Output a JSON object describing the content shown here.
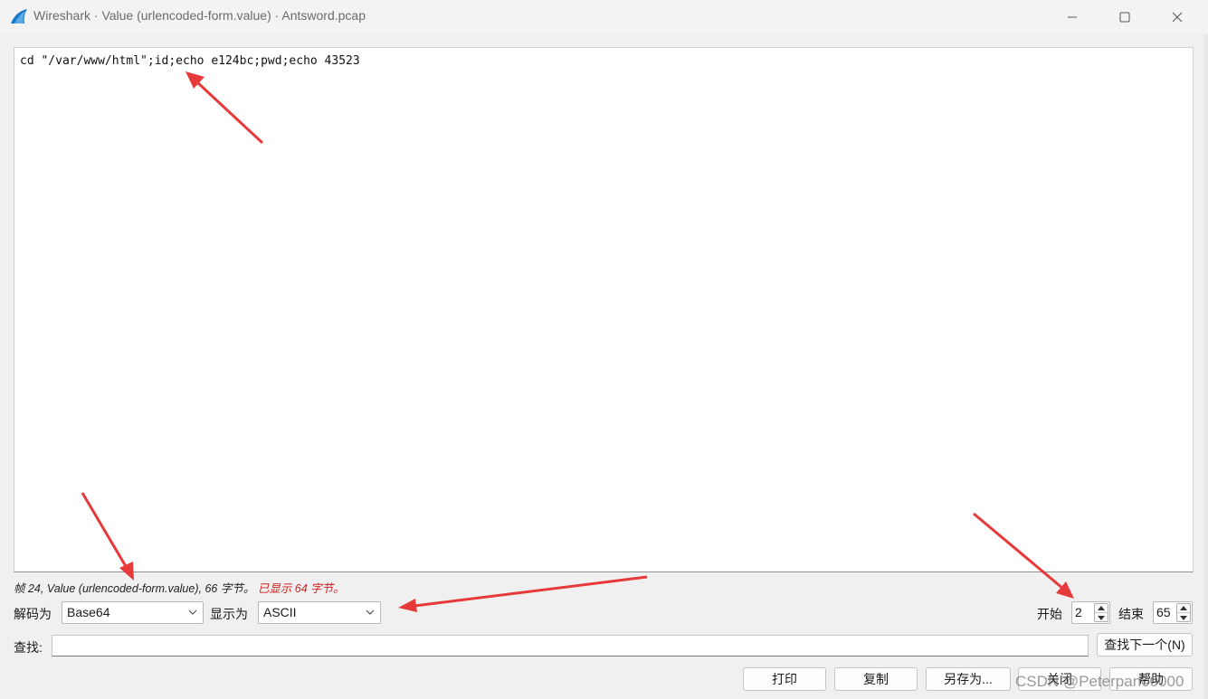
{
  "window": {
    "title": "Wireshark · Value (urlencoded-form.value) · Antsword.pcap",
    "minimize_icon": "minimize-icon",
    "maximize_icon": "maximize-icon",
    "close_icon": "close-icon"
  },
  "content": {
    "text": "cd \"/var/www/html\";id;echo e124bc;pwd;echo 43523"
  },
  "status": {
    "info": "帧 24, Value (urlencoded-form.value), 66 字节。",
    "shown": "已显示 64 字节。",
    "shown_color": "#d21f1f"
  },
  "controls": {
    "decode_label": "解码为",
    "decode_value": "Base64",
    "display_label": "显示为",
    "display_value": "ASCII",
    "start_label": "开始",
    "start_value": "2",
    "end_label": "结束",
    "end_value": "65"
  },
  "find": {
    "label": "查找:",
    "value": "",
    "next_button": "查找下一个(N)"
  },
  "buttons": {
    "print": "打印",
    "copy": "复制",
    "save_as": "另存为...",
    "close": "关闭",
    "help": "帮助"
  },
  "annotations": {
    "arrow_color": "#e8393a"
  },
  "watermark": "CSDN @Peterpan00000"
}
